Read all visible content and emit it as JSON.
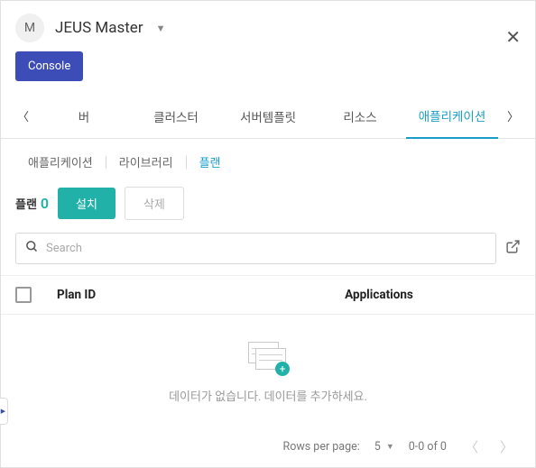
{
  "header": {
    "avatar_letter": "M",
    "title": "JEUS Master"
  },
  "console_button": "Console",
  "tabs": {
    "items": [
      "버",
      "클러스터",
      "서버템플릿",
      "리소스",
      "애플리케이션"
    ],
    "active_index": 4
  },
  "subtabs": {
    "items": [
      "애플리케이션",
      "라이브러리",
      "플랜"
    ],
    "active_index": 2
  },
  "toolbar": {
    "count_label": "플랜",
    "count_value": "0",
    "install_label": "설치",
    "delete_label": "삭제"
  },
  "search": {
    "placeholder": "Search"
  },
  "table": {
    "col_plan_id": "Plan ID",
    "col_applications": "Applications"
  },
  "empty_state": {
    "message": "데이터가 없습니다. 데이터를 추가하세요."
  },
  "pagination": {
    "rows_label": "Rows per page:",
    "page_size": "5",
    "range": "0-0 of 0"
  }
}
